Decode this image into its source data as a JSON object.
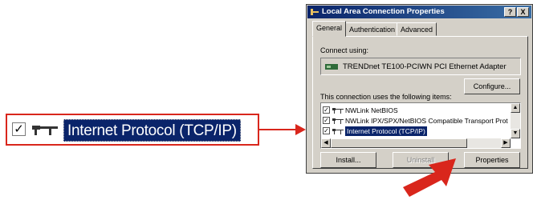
{
  "zoom_callout": {
    "checkbox_mark": "☑",
    "item_label": "Internet Protocol (TCP/IP)"
  },
  "dialog": {
    "title": "Local Area Connection Properties",
    "help_button": "?",
    "close_button": "X",
    "tabs": [
      {
        "label": "General",
        "active": true
      },
      {
        "label": "Authentication",
        "active": false
      },
      {
        "label": "Advanced",
        "active": false
      }
    ],
    "connect_using_label": "Connect using:",
    "adapter_name": "TRENDnet TE100-PCIWN PCI Ethernet Adapter",
    "configure_button": "Configure...",
    "items_label": "This connection uses the following items:",
    "items": [
      {
        "label": "NWLink NetBIOS",
        "checked": true,
        "selected": false
      },
      {
        "label": "NWLink IPX/SPX/NetBIOS Compatible Transport Prot",
        "checked": true,
        "selected": false
      },
      {
        "label": "Internet Protocol (TCP/IP)",
        "checked": true,
        "selected": true
      }
    ],
    "install_button": "Install...",
    "uninstall_button": "Uninstall",
    "properties_button": "Properties"
  },
  "colors": {
    "highlight": "#d9261c",
    "selection": "#0a246a",
    "face": "#d4d0c8"
  },
  "icons": [
    "network-protocol-icon",
    "network-adapter-icon",
    "connection-icon",
    "red-arrow-pointer"
  ]
}
